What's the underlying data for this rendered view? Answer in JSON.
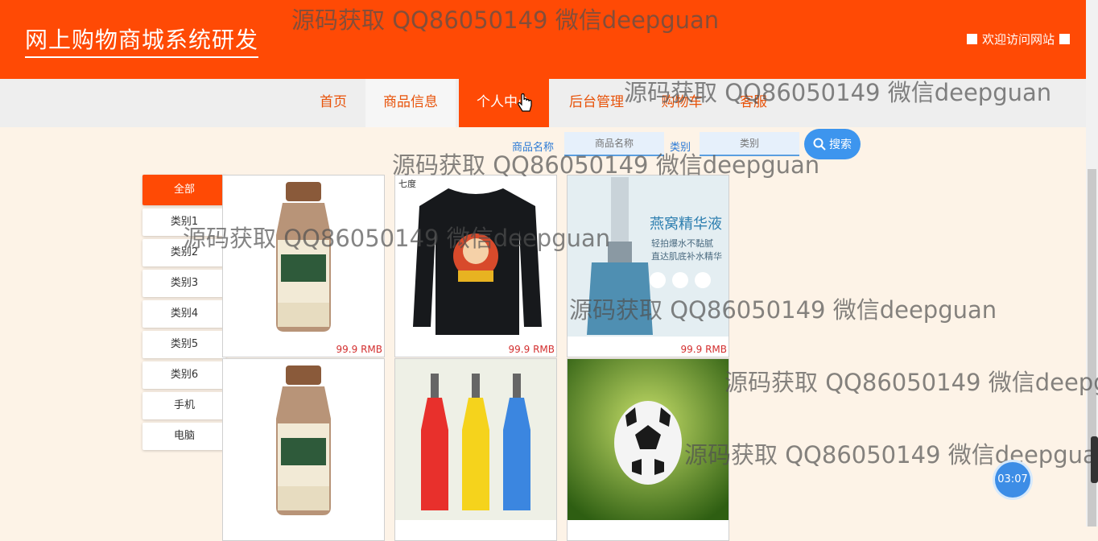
{
  "header": {
    "title": "网上购物商城系统研发",
    "welcome": "欢迎访问网站"
  },
  "nav": {
    "items": [
      "首页",
      "商品信息",
      "个人中心",
      "后台管理",
      "购物车",
      "客服"
    ],
    "active": "个人中心"
  },
  "search": {
    "name_label": "商品名称",
    "name_placeholder": "商品名称",
    "category_label": "类别",
    "category_placeholder": "类别",
    "button_label": "搜索"
  },
  "categories": [
    "全部",
    "类别1",
    "类别2",
    "类别3",
    "类别4",
    "类别5",
    "类别6",
    "手机",
    "电脑"
  ],
  "products": [
    {
      "price": "99.9 RMB",
      "image": "milk-tea-bottle"
    },
    {
      "price": "99.9 RMB",
      "image": "black-tshirt"
    },
    {
      "price": "99.9 RMB",
      "image": "bird-nest-essence"
    },
    {
      "price": "",
      "image": "milk-tea-bottle"
    },
    {
      "price": "",
      "image": "colorful-bottles"
    },
    {
      "price": "",
      "image": "soccer-ball"
    }
  ],
  "watermark": "源码获取 QQ86050149 微信deepguan",
  "product_image_text": {
    "tshirt_brand": "七度",
    "essence_title": "燕窝精华液",
    "essence_line1": "轻拍爆水不黏腻",
    "essence_line2": "直达肌底补水精华"
  },
  "timer": "03:07",
  "colors": {
    "brand": "#ff4a05",
    "accent_blue": "#3d95ee",
    "price_red": "#d32f2f",
    "page_bg": "#fdf3e7"
  }
}
